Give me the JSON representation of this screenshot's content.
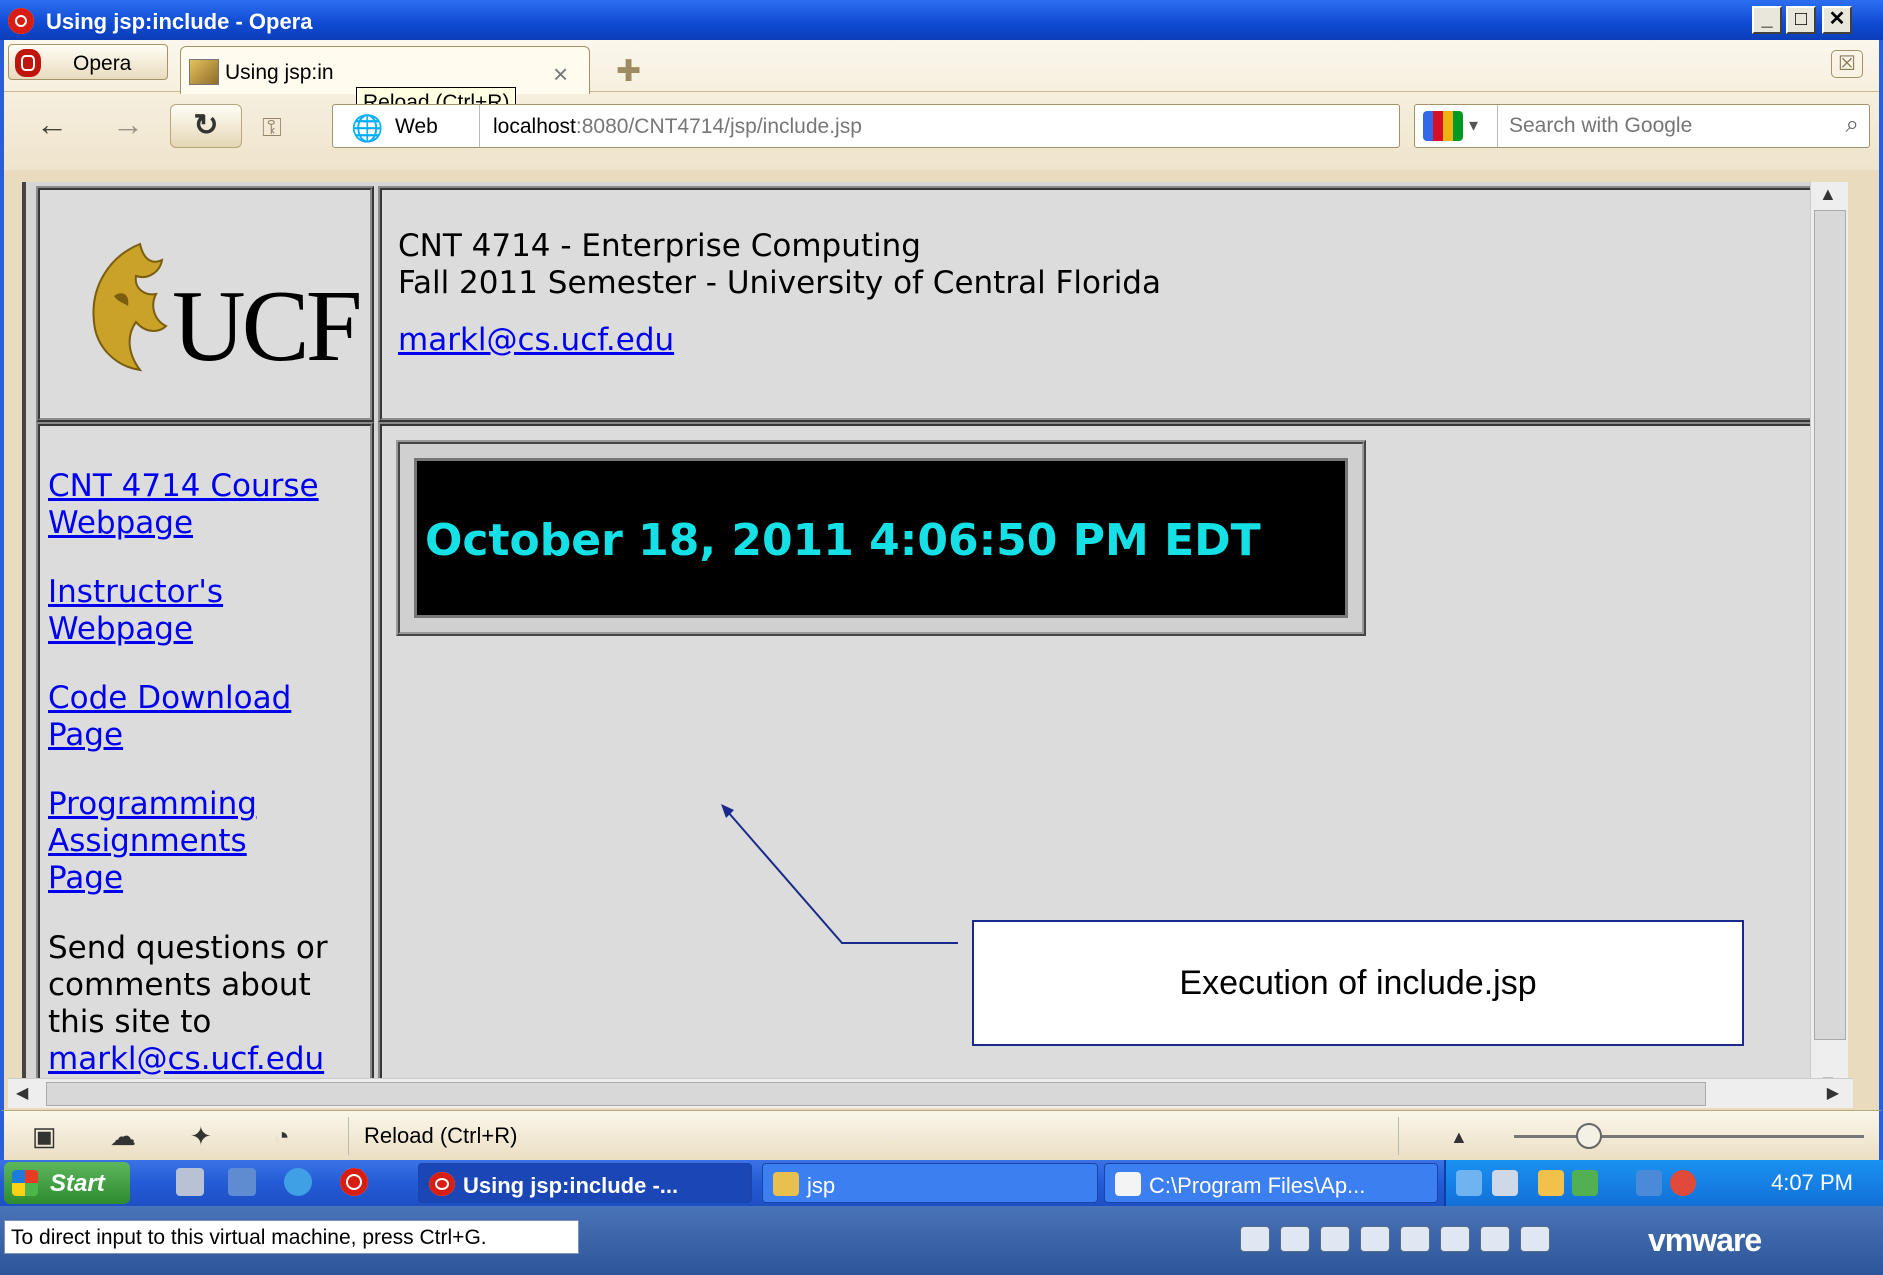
{
  "window": {
    "title": "Using jsp:include - Opera",
    "min": "_",
    "max": "□",
    "close": "✕"
  },
  "tabs": {
    "opera_menu": "Opera",
    "active_tab": "Using jsp:in",
    "tooltip": "Reload (Ctrl+R)",
    "close_glyph": "×",
    "new_tab_glyph": "✚"
  },
  "address": {
    "mode": "Web",
    "host": "localhost",
    "path": ":8080/CNT4714/jsp/include.jsp",
    "search_placeholder": "Search with Google"
  },
  "page": {
    "header_line1": "CNT 4714 - Enterprise Computing",
    "header_line2": "Fall 2011 Semester - University of Central Florida",
    "header_email": "markl@cs.ucf.edu",
    "logo_text": "UCF",
    "nav": [
      {
        "line1": "CNT 4714 Course",
        "line2": "Webpage"
      },
      {
        "line1": "Instructor's",
        "line2": "Webpage"
      },
      {
        "line1": "Code Download",
        "line2": "Page"
      },
      {
        "line1": "Programming",
        "line2": "Assignments",
        "line3": "Page"
      }
    ],
    "contact_line1": "Send questions or",
    "contact_line2": "comments about",
    "contact_line3": "this site to",
    "contact_email": "markl@cs.ucf.edu",
    "clock_text": "October 18, 2011 4:06:50 PM EDT"
  },
  "annotation": {
    "text": "Execution of include.jsp"
  },
  "statusbar": {
    "text": "Reload (Ctrl+R)"
  },
  "taskbar": {
    "start": "Start",
    "items": [
      {
        "label": "Using jsp:include -..."
      },
      {
        "label": "jsp"
      },
      {
        "label": "C:\\Program Files\\Ap..."
      }
    ],
    "time": "4:07 PM"
  },
  "vmware": {
    "hint": "To direct input to this virtual machine, press Ctrl+G.",
    "logo": "vmware"
  },
  "colors": {
    "clock_text": "#15e0e6",
    "link": "#0000ee",
    "titlebar": "#0f4ad1",
    "ucf_gold": "#c9a227"
  }
}
